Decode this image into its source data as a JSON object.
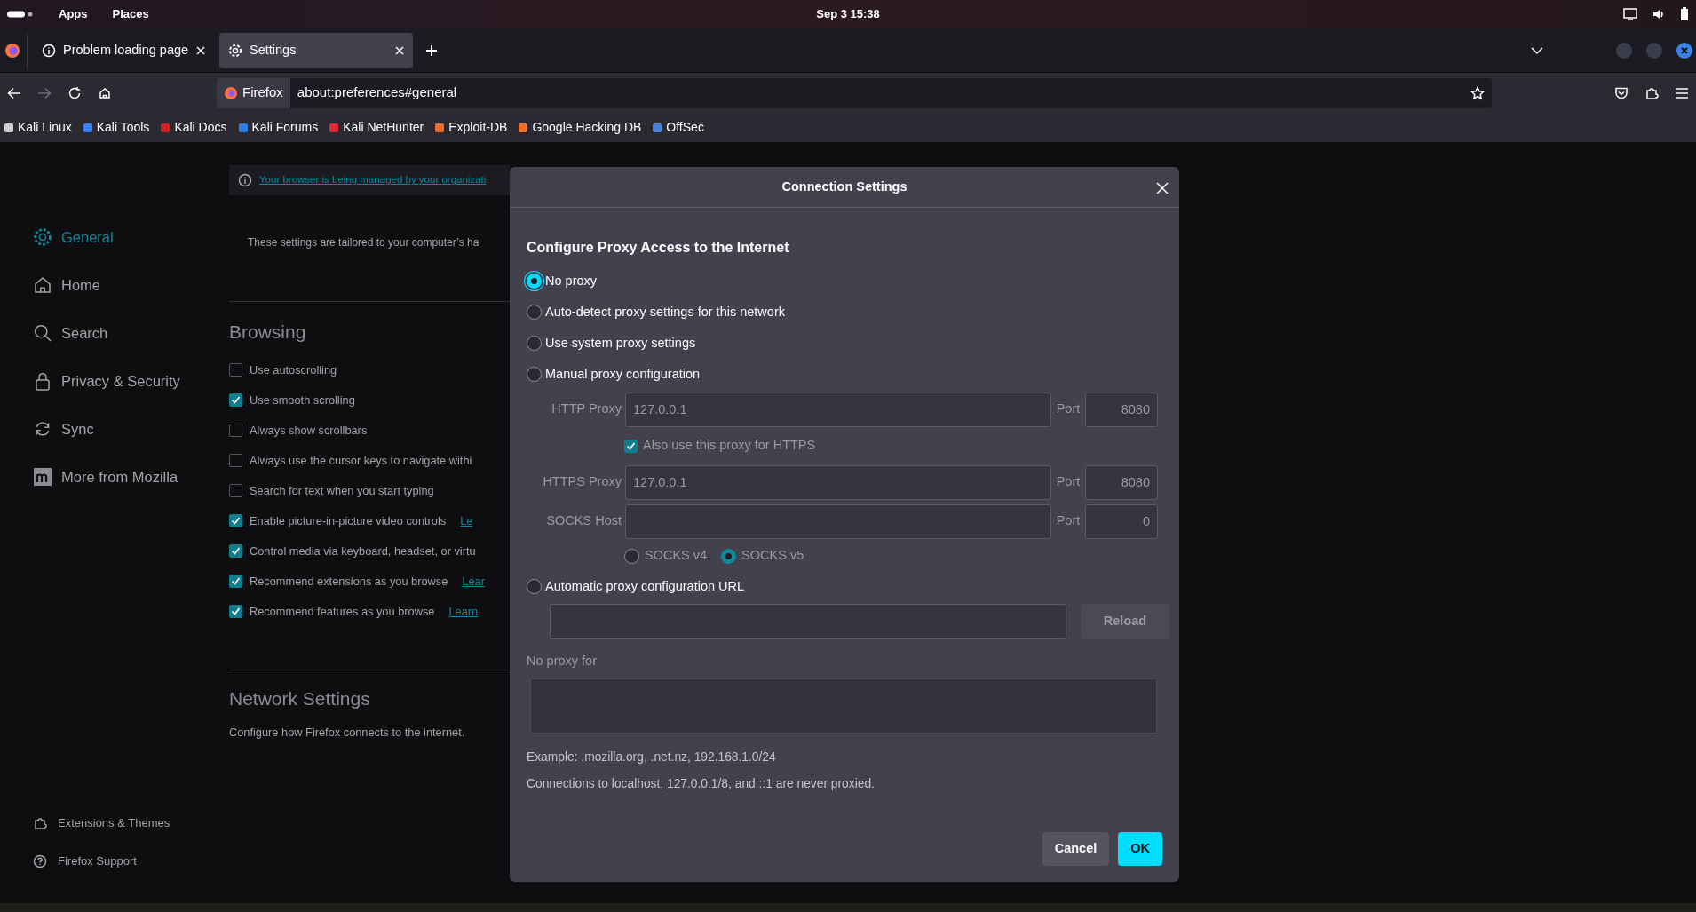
{
  "system_bar": {
    "menus": [
      "Apps",
      "Places"
    ],
    "clock": "Sep 3  15:38"
  },
  "tabs": [
    {
      "title": "Problem loading page",
      "selected": false
    },
    {
      "title": "Settings",
      "selected": true
    }
  ],
  "url_bar": {
    "identity": "Firefox",
    "url": "about:preferences#general"
  },
  "bookmarks": [
    {
      "label": "Kali Linux",
      "color": "#cfcfcf"
    },
    {
      "label": "Kali Tools",
      "color": "#3b82f6"
    },
    {
      "label": "Kali Docs",
      "color": "#d0202a"
    },
    {
      "label": "Kali Forums",
      "color": "#2f7de1"
    },
    {
      "label": "Kali NetHunter",
      "color": "#e0283a"
    },
    {
      "label": "Exploit-DB",
      "color": "#e8702a"
    },
    {
      "label": "Google Hacking DB",
      "color": "#e8702a"
    },
    {
      "label": "OffSec",
      "color": "#4a7fd6"
    }
  ],
  "sidebar": {
    "items": [
      {
        "label": "General",
        "selected": true
      },
      {
        "label": "Home",
        "selected": false
      },
      {
        "label": "Search",
        "selected": false
      },
      {
        "label": "Privacy & Security",
        "selected": false
      },
      {
        "label": "Sync",
        "selected": false
      },
      {
        "label": "More from Mozilla",
        "selected": false
      }
    ],
    "footer": [
      {
        "label": "Extensions & Themes"
      },
      {
        "label": "Firefox Support"
      }
    ]
  },
  "content": {
    "notice": "Your browser is being managed by your organizati",
    "tailored": "These settings are tailored to your computer’s ha",
    "browsing_heading": "Browsing",
    "options": [
      {
        "label": "Use autoscrolling",
        "checked": false
      },
      {
        "label": "Use smooth scrolling",
        "checked": true
      },
      {
        "label": "Always show scrollbars",
        "checked": false
      },
      {
        "label": "Always use the cursor keys to navigate withi",
        "checked": false
      },
      {
        "label": "Search for text when you start typing",
        "checked": false
      },
      {
        "label": "Enable picture-in-picture video controls",
        "checked": true,
        "link": "Le"
      },
      {
        "label": "Control media via keyboard, headset, or virtu",
        "checked": true
      },
      {
        "label": "Recommend extensions as you browse",
        "checked": true,
        "link": "Lear"
      },
      {
        "label": "Recommend features as you browse",
        "checked": true,
        "link": "Learn"
      }
    ],
    "network_heading": "Network Settings",
    "network_text": "Configure how Firefox connects to the internet."
  },
  "dialog": {
    "title": "Connection Settings",
    "heading": "Configure Proxy Access to the Internet",
    "rows": [
      {
        "kind": "radio",
        "label": "No proxy",
        "selected": true
      },
      {
        "kind": "radio",
        "label": "Auto-detect proxy settings for this network",
        "selected": false
      },
      {
        "kind": "radio",
        "label": "Use system proxy settings",
        "selected": false
      },
      {
        "kind": "radio",
        "label": "Manual proxy configuration",
        "selected": false
      },
      {
        "kind": "proxy",
        "label": "HTTP Proxy",
        "value": "127.0.0.1",
        "port_label": "Port",
        "port": "8080",
        "disabled": true
      },
      {
        "kind": "checkbox",
        "label": "Also use this proxy for HTTPS",
        "checked": true,
        "disabled": true
      },
      {
        "kind": "proxy",
        "label": "HTTPS Proxy",
        "value": "127.0.0.1",
        "port_label": "Port",
        "port": "8080",
        "disabled": true
      },
      {
        "kind": "proxy",
        "label": "SOCKS Host",
        "value": "",
        "port_label": "Port",
        "port": "0",
        "disabled": true
      },
      {
        "kind": "versions",
        "options": [
          {
            "label": "SOCKS v4",
            "selected": false
          },
          {
            "label": "SOCKS v5",
            "selected": true
          }
        ],
        "disabled": true
      },
      {
        "kind": "radio",
        "label": "Automatic proxy configuration URL",
        "selected": false
      },
      {
        "kind": "url",
        "button": "Reload",
        "disabled": true
      },
      {
        "kind": "label",
        "label": "No proxy for",
        "disabled": true
      },
      {
        "kind": "textarea",
        "disabled": true
      },
      {
        "kind": "note",
        "label": "Example: .mozilla.org, .net.nz, 192.168.1.0/24"
      },
      {
        "kind": "note",
        "label": "Connections to localhost, 127.0.0.1/8, and ::1 are never proxied."
      }
    ],
    "buttons": [
      {
        "label": "Cancel",
        "primary": false
      },
      {
        "label": "OK",
        "primary": true
      }
    ]
  }
}
